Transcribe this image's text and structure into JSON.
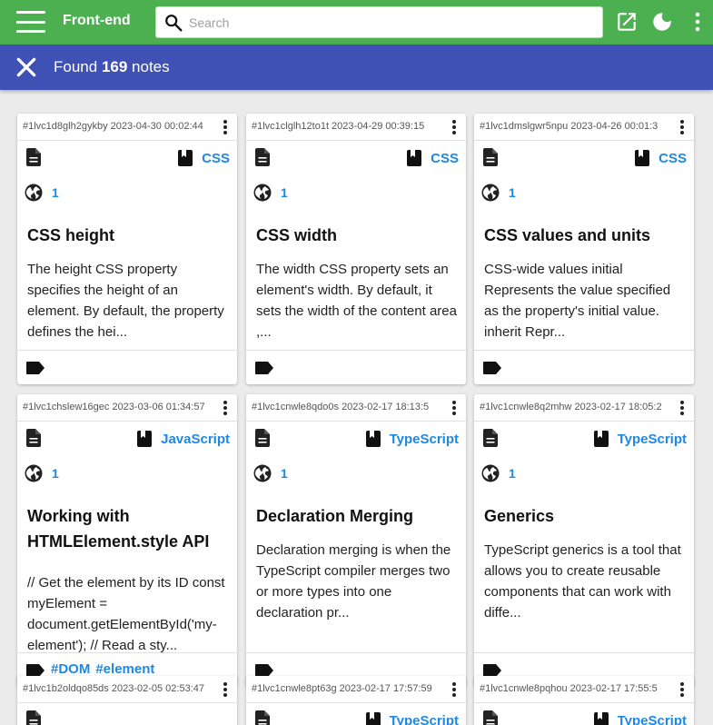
{
  "app": {
    "title": "Front-end"
  },
  "search": {
    "placeholder": "Search",
    "value": ""
  },
  "found": {
    "prefix": "Found",
    "count": "169",
    "suffix": "notes"
  },
  "icons": {
    "menu": "menu-icon",
    "search": "search-icon",
    "open": "open-in-new-icon",
    "theme": "dark-mode-icon",
    "more": "more-vert-icon",
    "close": "close-icon",
    "doc": "document-icon",
    "book": "book-icon",
    "globe": "globe-icon",
    "label": "label-icon"
  },
  "colors": {
    "topbar": "#4caf50",
    "found_bar": "#3f51b5",
    "link": "#1e88e5"
  },
  "cards": [
    {
      "id": "#1lvc1d8glh2gykby 2023-04-30 00:02:44",
      "lang": "CSS",
      "count": "1",
      "title": "CSS height",
      "desc": "The height CSS property specifies the height of an element. By default, the property defines the hei...",
      "tags": []
    },
    {
      "id": "#1lvc1clglh12to1t 2023-04-29 00:39:15",
      "lang": "CSS",
      "count": "1",
      "title": "CSS width",
      "desc": "The width CSS property sets an element's width. By default, it sets the width of the content area ,...",
      "tags": []
    },
    {
      "id": "#1lvc1dmslgwr5npu 2023-04-26 00:01:3",
      "lang": "CSS",
      "count": "1",
      "title": "CSS values and units",
      "desc": "CSS-wide values initial Represents the value specified as the property's initial value. inherit Repr...",
      "tags": []
    },
    {
      "id": "#1lvc1chslew16gec 2023-03-06 01:34:57",
      "lang": "JavaScript",
      "count": "1",
      "title": "Working with HTMLElement.style API",
      "desc": "// Get the element by its ID const myElement = document.getElementById('my-element'); // Read a sty...",
      "tags": [
        "#DOM",
        "#element"
      ]
    },
    {
      "id": "#1lvc1cnwle8qdo0s 2023-02-17 18:13:5",
      "lang": "TypeScript",
      "count": "1",
      "title": "Declaration Merging",
      "desc": "Declaration merging is when the TypeScript compiler merges two or more types into one declaration pr...",
      "tags": []
    },
    {
      "id": "#1lvc1cnwle8q2mhw 2023-02-17 18:05:2",
      "lang": "TypeScript",
      "count": "1",
      "title": "Generics",
      "desc": "TypeScript generics is a tool that allows you to create reusable components that can work with diffe...",
      "tags": []
    },
    {
      "id": "#1lvc1b2oldqo85ds 2023-02-05 02:53:47",
      "lang": "",
      "count": "",
      "title": "",
      "desc": "",
      "tags": []
    },
    {
      "id": "#1lvc1cnwle8pt63g 2023-02-17 17:57:59",
      "lang": "TypeScript",
      "count": "",
      "title": "",
      "desc": "",
      "tags": []
    },
    {
      "id": "#1lvc1cnwle8pqhou 2023-02-17 17:55:5",
      "lang": "TypeScript",
      "count": "",
      "title": "",
      "desc": "",
      "tags": []
    }
  ]
}
